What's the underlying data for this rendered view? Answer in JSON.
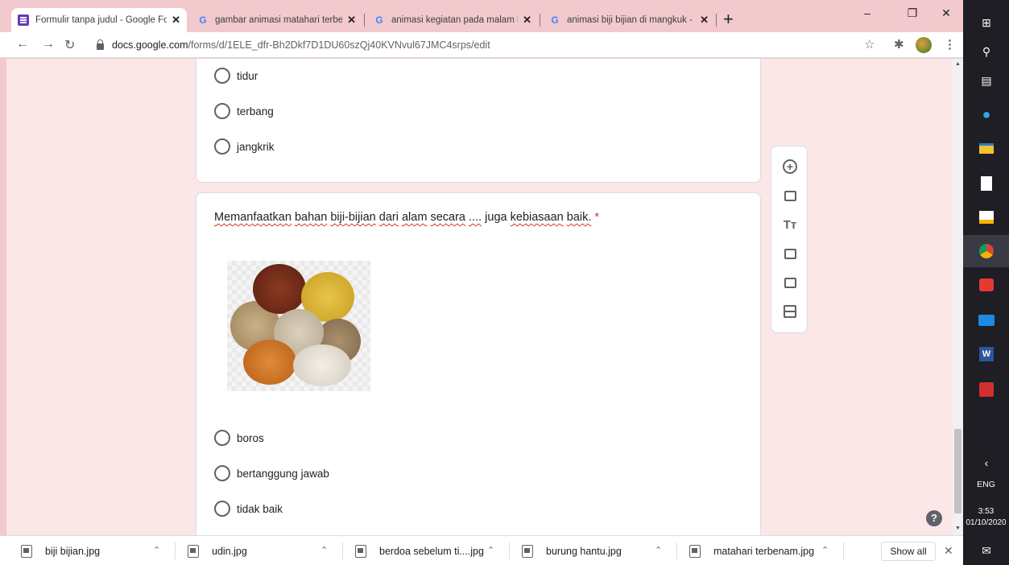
{
  "browser": {
    "tabs": [
      {
        "title": "Formulir tanpa judul - Google Fo",
        "icon": "forms-icon",
        "active": true
      },
      {
        "title": "gambar animasi matahari terben",
        "icon": "google-icon",
        "active": false
      },
      {
        "title": "animasi kegiatan pada malam ha",
        "icon": "google-icon",
        "active": false
      },
      {
        "title": "animasi biji bijian di mangkuk - G",
        "icon": "google-icon",
        "active": false
      }
    ],
    "close_glyph": "✕",
    "new_tab_glyph": "+",
    "url_host": "docs.google.com",
    "url_path": "/forms/d/1ELE_dfr-Bh2Dkf7D1DU60szQj40KVNvul67JMC4srps/edit",
    "accent": "#673ab7"
  },
  "form": {
    "prev_question": {
      "options": [
        "tidur",
        "terbang",
        "jangkrik"
      ]
    },
    "question": {
      "words": [
        "Memanfaatkan",
        "bahan",
        "biji-bijian",
        "dari",
        "alam",
        "secara",
        "....",
        "juga",
        "kebiasaan",
        "baik."
      ],
      "required_mark": "*",
      "image_alt": "biji bijian",
      "options": [
        "boros",
        "bertanggung jawab",
        "tidak baik"
      ]
    },
    "side_tools": [
      "add-question-icon",
      "import-questions-icon",
      "add-title-icon",
      "add-image-icon",
      "add-video-icon",
      "add-section-icon"
    ],
    "help_glyph": "?"
  },
  "downloads": {
    "items": [
      "biji bijian.jpg",
      "udin.jpg",
      "berdoa sebelum ti....jpg",
      "burung hantu.jpg",
      "matahari terbenam.jpg"
    ],
    "show_all": "Show all"
  },
  "taskbar": {
    "language": "ENG",
    "time": "3:53",
    "date": "01/10/2020"
  }
}
